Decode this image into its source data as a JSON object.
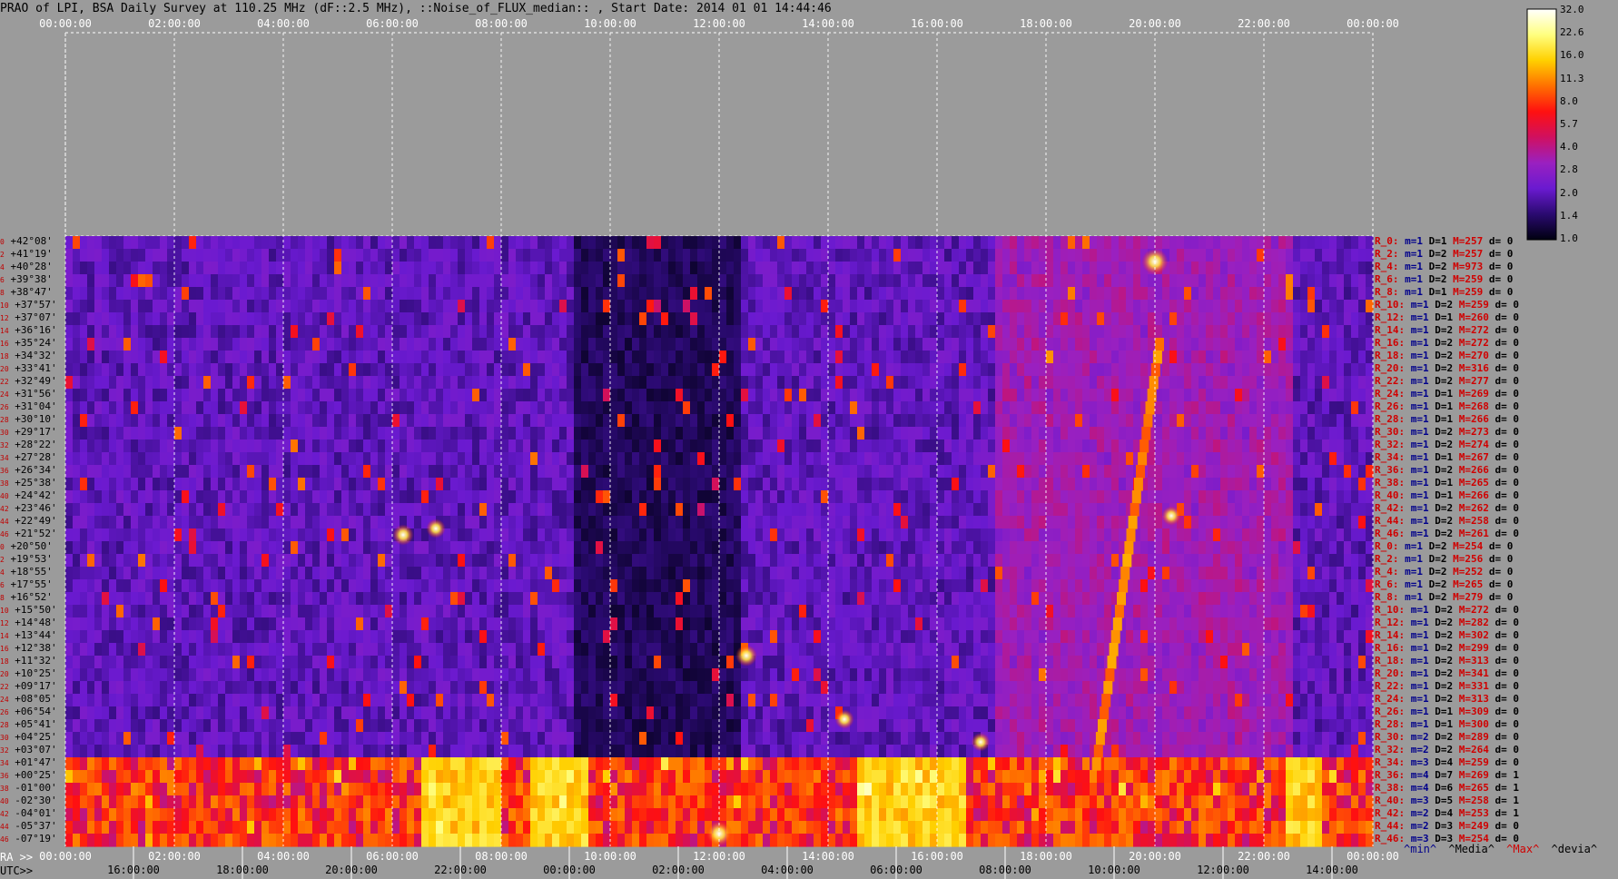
{
  "title": "PRAO of LPI, BSA Daily Survey at 110.25 MHz (dF::2.5 MHz), ::Noise_of_FLUX_median:: , Start Date: 2014 01 01 14:44:46",
  "footer": {
    "ra_label": "RA >>",
    "utc_label": "UTC>>",
    "legend_min": "^min^",
    "legend_median": "^Media^",
    "legend_max": "^Max^",
    "legend_devia": "^devia^"
  },
  "colors": {
    "background": "#9b9b9b",
    "legend_min": "#00008b",
    "legend_median": "#000000",
    "legend_max": "#d00000",
    "legend_devia": "#000000"
  },
  "chart_data": {
    "type": "heatmap",
    "title": "PRAO of LPI, BSA Daily Survey at 110.25 MHz (dF::2.5 MHz), ::Noise_of_FLUX_median:: , Start Date: 2014 01 01 14:44:46",
    "x_top_ticks": [
      "00:00:00",
      "02:00:00",
      "04:00:00",
      "06:00:00",
      "08:00:00",
      "10:00:00",
      "12:00:00",
      "14:00:00",
      "16:00:00",
      "18:00:00",
      "20:00:00",
      "22:00:00",
      "00:00:00"
    ],
    "x_ra_ticks": [
      "00:00:00",
      "02:00:00",
      "04:00:00",
      "06:00:00",
      "08:00:00",
      "10:00:00",
      "12:00:00",
      "14:00:00",
      "16:00:00",
      "18:00:00",
      "20:00:00",
      "22:00:00",
      "00:00:00"
    ],
    "x_utc_ticks": [
      "16:00:00",
      "18:00:00",
      "20:00:00",
      "22:00:00",
      "00:00:00",
      "02:00:00",
      "04:00:00",
      "06:00:00",
      "08:00:00",
      "10:00:00",
      "12:00:00",
      "14:00:00"
    ],
    "declinations": [
      "+42°08'",
      "+41°19'",
      "+40°28'",
      "+39°38'",
      "+38°47'",
      "+37°57'",
      "+37°07'",
      "+36°16'",
      "+35°24'",
      "+34°32'",
      "+33°41'",
      "+32°49'",
      "+31°56'",
      "+31°04'",
      "+30°10'",
      "+29°17'",
      "+28°22'",
      "+27°28'",
      "+26°34'",
      "+25°38'",
      "+24°42'",
      "+23°46'",
      "+22°49'",
      "+21°52'",
      "+20°50'",
      "+19°53'",
      "+18°55'",
      "+17°55'",
      "+16°52'",
      "+15°50'",
      "+14°48'",
      "+13°44'",
      "+12°38'",
      "+11°32'",
      "+10°25'",
      "+09°17'",
      "+08°05'",
      "+06°54'",
      "+05°41'",
      "+04°25'",
      "+03°07'",
      "+01°47'",
      "+00°25'",
      "-01°00'",
      "-02°30'",
      "-04°01'",
      "-05°37'",
      "-07°19'"
    ],
    "beam_indices": [
      "0",
      "2",
      "4",
      "6",
      "8",
      "10",
      "12",
      "14",
      "16",
      "18",
      "20",
      "22",
      "24",
      "26",
      "28",
      "30",
      "32",
      "34",
      "36",
      "38",
      "40",
      "42",
      "44",
      "46",
      "0",
      "2",
      "4",
      "6",
      "8",
      "10",
      "12",
      "14",
      "16",
      "18",
      "20",
      "22",
      "24",
      "26",
      "28",
      "30",
      "32",
      "34",
      "36",
      "38",
      "40",
      "42",
      "44",
      "46"
    ],
    "beam_stats": [
      {
        "r": "R_0:",
        "m": "m=1",
        "d": "D=1",
        "mx": "M=257",
        "dev": "d= 0"
      },
      {
        "r": "R_2:",
        "m": "m=1",
        "d": "D=2",
        "mx": "M=257",
        "dev": "d= 0"
      },
      {
        "r": "R_4:",
        "m": "m=1",
        "d": "D=2",
        "mx": "M=973",
        "dev": "d= 0"
      },
      {
        "r": "R_6:",
        "m": "m=1",
        "d": "D=2",
        "mx": "M=259",
        "dev": "d= 0"
      },
      {
        "r": "R_8:",
        "m": "m=1",
        "d": "D=1",
        "mx": "M=259",
        "dev": "d= 0"
      },
      {
        "r": "R_10:",
        "m": "m=1",
        "d": "D=2",
        "mx": "M=259",
        "dev": "d= 0"
      },
      {
        "r": "R_12:",
        "m": "m=1",
        "d": "D=1",
        "mx": "M=260",
        "dev": "d= 0"
      },
      {
        "r": "R_14:",
        "m": "m=1",
        "d": "D=2",
        "mx": "M=272",
        "dev": "d= 0"
      },
      {
        "r": "R_16:",
        "m": "m=1",
        "d": "D=2",
        "mx": "M=272",
        "dev": "d= 0"
      },
      {
        "r": "R_18:",
        "m": "m=1",
        "d": "D=2",
        "mx": "M=270",
        "dev": "d= 0"
      },
      {
        "r": "R_20:",
        "m": "m=1",
        "d": "D=2",
        "mx": "M=316",
        "dev": "d= 0"
      },
      {
        "r": "R_22:",
        "m": "m=1",
        "d": "D=2",
        "mx": "M=277",
        "dev": "d= 0"
      },
      {
        "r": "R_24:",
        "m": "m=1",
        "d": "D=1",
        "mx": "M=269",
        "dev": "d= 0"
      },
      {
        "r": "R_26:",
        "m": "m=1",
        "d": "D=1",
        "mx": "M=268",
        "dev": "d= 0"
      },
      {
        "r": "R_28:",
        "m": "m=1",
        "d": "D=1",
        "mx": "M=266",
        "dev": "d= 0"
      },
      {
        "r": "R_30:",
        "m": "m=1",
        "d": "D=2",
        "mx": "M=273",
        "dev": "d= 0"
      },
      {
        "r": "R_32:",
        "m": "m=1",
        "d": "D=2",
        "mx": "M=274",
        "dev": "d= 0"
      },
      {
        "r": "R_34:",
        "m": "m=1",
        "d": "D=1",
        "mx": "M=267",
        "dev": "d= 0"
      },
      {
        "r": "R_36:",
        "m": "m=1",
        "d": "D=2",
        "mx": "M=266",
        "dev": "d= 0"
      },
      {
        "r": "R_38:",
        "m": "m=1",
        "d": "D=1",
        "mx": "M=265",
        "dev": "d= 0"
      },
      {
        "r": "R_40:",
        "m": "m=1",
        "d": "D=1",
        "mx": "M=266",
        "dev": "d= 0"
      },
      {
        "r": "R_42:",
        "m": "m=1",
        "d": "D=2",
        "mx": "M=262",
        "dev": "d= 0"
      },
      {
        "r": "R_44:",
        "m": "m=1",
        "d": "D=2",
        "mx": "M=258",
        "dev": "d= 0"
      },
      {
        "r": "R_46:",
        "m": "m=1",
        "d": "D=2",
        "mx": "M=261",
        "dev": "d= 0"
      },
      {
        "r": "R_0:",
        "m": "m=1",
        "d": "D=2",
        "mx": "M=254",
        "dev": "d= 0"
      },
      {
        "r": "R_2:",
        "m": "m=1",
        "d": "D=2",
        "mx": "M=256",
        "dev": "d= 0"
      },
      {
        "r": "R_4:",
        "m": "m=1",
        "d": "D=2",
        "mx": "M=252",
        "dev": "d= 0"
      },
      {
        "r": "R_6:",
        "m": "m=1",
        "d": "D=2",
        "mx": "M=265",
        "dev": "d= 0"
      },
      {
        "r": "R_8:",
        "m": "m=1",
        "d": "D=2",
        "mx": "M=279",
        "dev": "d= 0"
      },
      {
        "r": "R_10:",
        "m": "m=1",
        "d": "D=2",
        "mx": "M=272",
        "dev": "d= 0"
      },
      {
        "r": "R_12:",
        "m": "m=1",
        "d": "D=2",
        "mx": "M=282",
        "dev": "d= 0"
      },
      {
        "r": "R_14:",
        "m": "m=1",
        "d": "D=2",
        "mx": "M=302",
        "dev": "d= 0"
      },
      {
        "r": "R_16:",
        "m": "m=1",
        "d": "D=2",
        "mx": "M=299",
        "dev": "d= 0"
      },
      {
        "r": "R_18:",
        "m": "m=1",
        "d": "D=2",
        "mx": "M=313",
        "dev": "d= 0"
      },
      {
        "r": "R_20:",
        "m": "m=1",
        "d": "D=2",
        "mx": "M=341",
        "dev": "d= 0"
      },
      {
        "r": "R_22:",
        "m": "m=1",
        "d": "D=2",
        "mx": "M=331",
        "dev": "d= 0"
      },
      {
        "r": "R_24:",
        "m": "m=1",
        "d": "D=2",
        "mx": "M=313",
        "dev": "d= 0"
      },
      {
        "r": "R_26:",
        "m": "m=1",
        "d": "D=1",
        "mx": "M=309",
        "dev": "d= 0"
      },
      {
        "r": "R_28:",
        "m": "m=1",
        "d": "D=1",
        "mx": "M=300",
        "dev": "d= 0"
      },
      {
        "r": "R_30:",
        "m": "m=2",
        "d": "D=2",
        "mx": "M=289",
        "dev": "d= 0"
      },
      {
        "r": "R_32:",
        "m": "m=2",
        "d": "D=2",
        "mx": "M=264",
        "dev": "d= 0"
      },
      {
        "r": "R_34:",
        "m": "m=3",
        "d": "D=4",
        "mx": "M=259",
        "dev": "d= 0"
      },
      {
        "r": "R_36:",
        "m": "m=4",
        "d": "D=7",
        "mx": "M=269",
        "dev": "d= 1"
      },
      {
        "r": "R_38:",
        "m": "m=4",
        "d": "D=6",
        "mx": "M=265",
        "dev": "d= 1"
      },
      {
        "r": "R_40:",
        "m": "m=3",
        "d": "D=5",
        "mx": "M=258",
        "dev": "d= 1"
      },
      {
        "r": "R_42:",
        "m": "m=2",
        "d": "D=4",
        "mx": "M=253",
        "dev": "d= 1"
      },
      {
        "r": "R_44:",
        "m": "m=2",
        "d": "D=3",
        "mx": "M=249",
        "dev": "d= 0"
      },
      {
        "r": "R_46:",
        "m": "m=3",
        "d": "D=3",
        "mx": "M=254",
        "dev": "d= 0"
      }
    ],
    "colorbar": {
      "ticks": [
        "32.0",
        "22.6",
        "16.0",
        "11.3",
        "8.0",
        "5.7",
        "4.0",
        "2.8",
        "2.0",
        "1.4",
        "1.0"
      ],
      "range": [
        1.0,
        32.0
      ],
      "scale": "log",
      "colormap": [
        "#000010",
        "#2a0a70",
        "#6a1ad0",
        "#9a20c0",
        "#d01060",
        "#ff1010",
        "#ff7000",
        "#ffd000",
        "#ffff80",
        "#ffffff"
      ]
    },
    "features": [
      {
        "ra_hours": 20.0,
        "dec_index": 1.5,
        "intensity": 32
      },
      {
        "ra_hours": 6.2,
        "dec_index": 23.0,
        "intensity": 12
      },
      {
        "ra_hours": 12.5,
        "dec_index": 32.5,
        "intensity": 14
      },
      {
        "ra_hours": 6.8,
        "dec_index": 22.5,
        "intensity": 9
      },
      {
        "ra_hours": 14.3,
        "dec_index": 37.5,
        "intensity": 9
      },
      {
        "ra_hours": 16.8,
        "dec_index": 39.3,
        "intensity": 8
      },
      {
        "ra_hours": 12.0,
        "dec_index": 46.5,
        "intensity": 32
      },
      {
        "ra_hours": 20.3,
        "dec_index": 21.5,
        "intensity": 9
      }
    ],
    "grid": true
  }
}
